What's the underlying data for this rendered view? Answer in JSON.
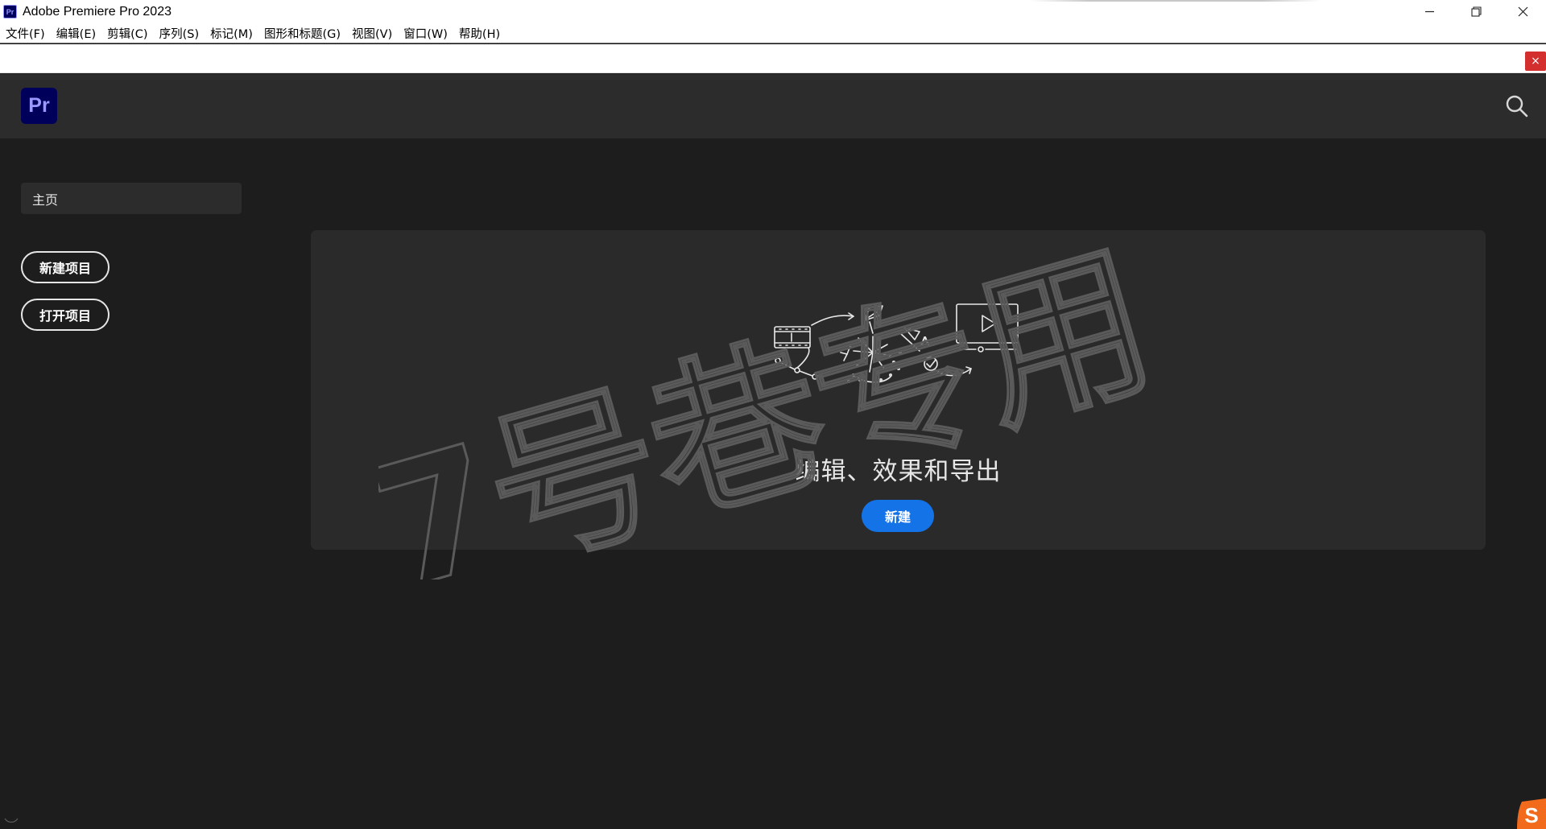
{
  "window": {
    "app_icon_text": "Pr",
    "title": "Adobe Premiere Pro 2023"
  },
  "menu": {
    "items": [
      {
        "label": "文件(F)"
      },
      {
        "label": "编辑(E)"
      },
      {
        "label": "剪辑(C)"
      },
      {
        "label": "序列(S)"
      },
      {
        "label": "标记(M)"
      },
      {
        "label": "图形和标题(G)"
      },
      {
        "label": "视图(V)"
      },
      {
        "label": "窗口(W)"
      },
      {
        "label": "帮助(H)"
      }
    ]
  },
  "strip": {
    "close_glyph": "×"
  },
  "header": {
    "logo_text": "Pr"
  },
  "sidebar": {
    "home_label": "主页",
    "new_project_label": "新建项目",
    "open_project_label": "打开项目"
  },
  "card": {
    "title": "编辑、效果和导出",
    "button_label": "新建"
  },
  "watermark": {
    "text": "7号巷专用"
  },
  "colors": {
    "accent": "#1473e6",
    "pr_logo_bg": "#00005b",
    "pr_logo_fg": "#9999ff",
    "close_red": "#d32f2f"
  }
}
